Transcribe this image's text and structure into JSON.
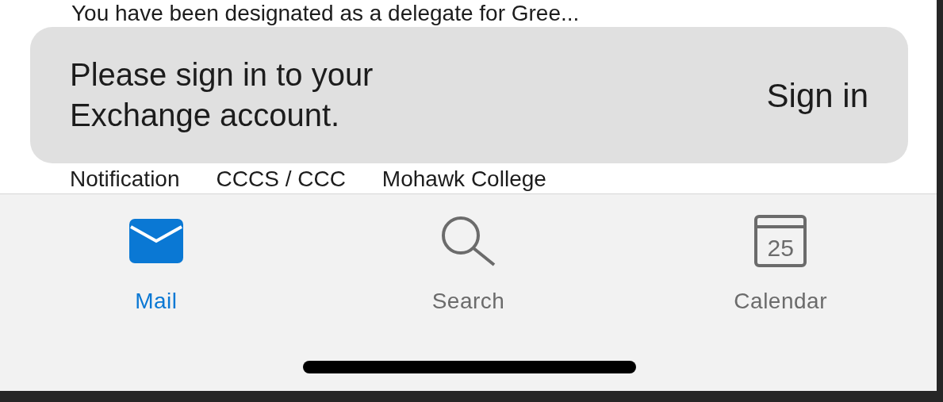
{
  "background_message": {
    "preview": "You have been designated as a delegate for Gree..."
  },
  "banner": {
    "message": "Please sign in to your Exchange account.",
    "action": "Sign in"
  },
  "list_row": {
    "columns": [
      "Notification",
      "CCCS / CCC",
      "Mohawk College"
    ]
  },
  "tab_bar": {
    "tabs": [
      {
        "kind": "mail",
        "label": "Mail",
        "selected": true
      },
      {
        "kind": "search",
        "label": "Search",
        "selected": false
      },
      {
        "kind": "calendar",
        "label": "Calendar",
        "day": "25",
        "selected": false
      }
    ]
  }
}
